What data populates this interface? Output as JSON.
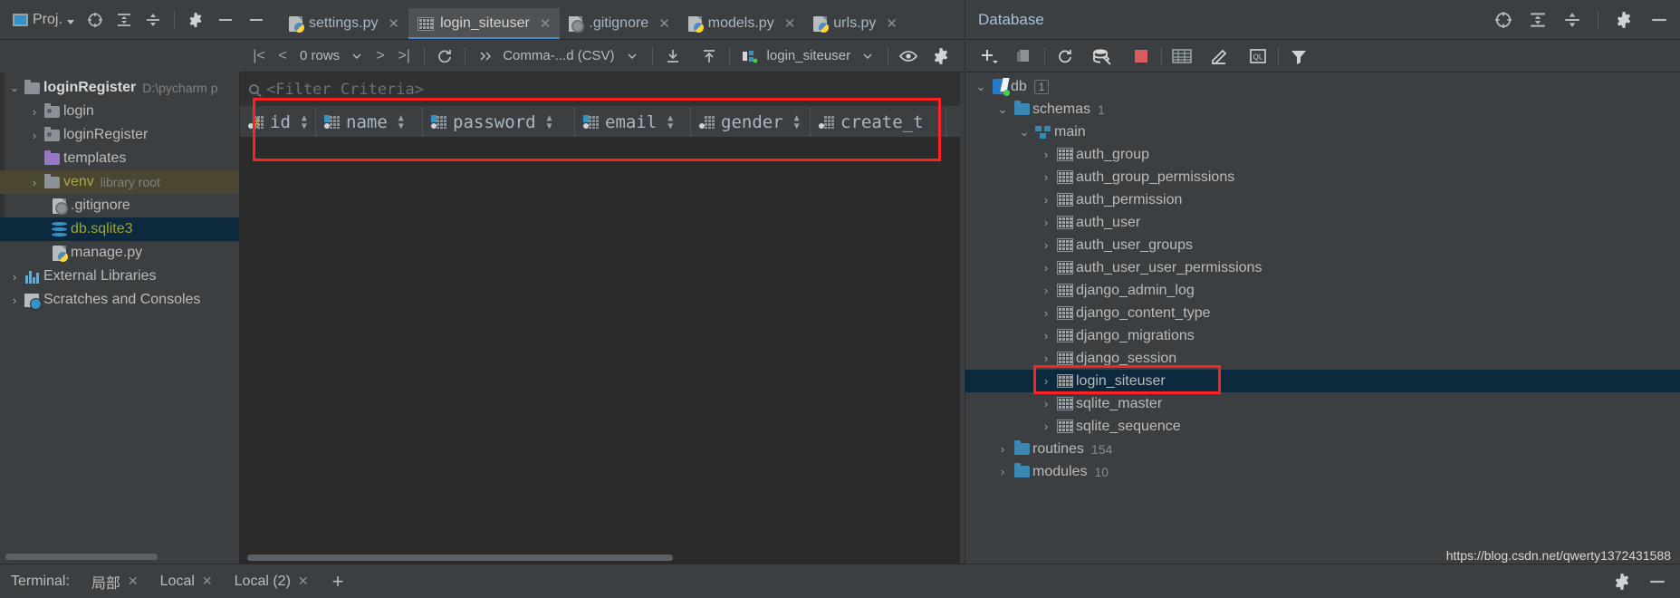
{
  "project_panel": {
    "title": "Proj.",
    "header_icons": [
      "locate-icon",
      "expand-all-icon",
      "collapse-all-icon",
      "settings-gear-icon",
      "minimize-icon"
    ],
    "tree": [
      {
        "name": "loginRegister",
        "sub": "D:\\pycharm p",
        "arrow": "v",
        "icon": "folder-icon",
        "style": "bold",
        "indent": 0
      },
      {
        "name": "login",
        "sub": "",
        "arrow": ">",
        "icon": "module-folder-icon",
        "style": "normal",
        "indent": 1
      },
      {
        "name": "loginRegister",
        "sub": "",
        "arrow": ">",
        "icon": "module-folder-icon",
        "style": "normal",
        "indent": 1
      },
      {
        "name": "templates",
        "sub": "",
        "arrow": "",
        "icon": "folder-purple-icon",
        "style": "normal",
        "indent": 1
      },
      {
        "name": "venv",
        "sub": "library root",
        "arrow": ">",
        "icon": "folder-icon",
        "style": "venv",
        "indent": 1
      },
      {
        "name": ".gitignore",
        "sub": "",
        "arrow": "",
        "icon": "gitignore-file-icon",
        "style": "normal",
        "indent": 2
      },
      {
        "name": "db.sqlite3",
        "sub": "",
        "arrow": "",
        "icon": "database-file-icon",
        "style": "green",
        "indent": 2
      },
      {
        "name": "manage.py",
        "sub": "",
        "arrow": "",
        "icon": "python-file-icon",
        "style": "normal",
        "indent": 2
      },
      {
        "name": "External Libraries",
        "sub": "",
        "arrow": ">",
        "icon": "libraries-icon",
        "style": "normal",
        "indent": 0
      },
      {
        "name": "Scratches and Consoles",
        "sub": "",
        "arrow": ">",
        "icon": "scratches-icon",
        "style": "normal",
        "indent": 0
      }
    ]
  },
  "editor": {
    "tabs": [
      {
        "label": "settings.py",
        "icon": "python-file-icon",
        "active": false
      },
      {
        "label": "login_siteuser",
        "icon": "table-icon",
        "active": true
      },
      {
        "label": ".gitignore",
        "icon": "gitignore-file-icon",
        "active": false
      },
      {
        "label": "models.py",
        "icon": "python-file-icon",
        "active": false
      },
      {
        "label": "urls.py",
        "icon": "python-file-icon",
        "active": false
      }
    ]
  },
  "grid_toolbar": {
    "first_page": "|<",
    "prev_page": "<",
    "rows_label": "0 rows",
    "next_page": ">",
    "last_page": ">|",
    "reload_icon": "refresh-icon",
    "more_icon": "chevron-double-right-icon",
    "format_label": "Comma-...d (CSV)",
    "download_icon": "download-icon",
    "upload_icon": "upload-icon",
    "session_label": "login_siteuser",
    "view_icon": "eye-icon",
    "settings_icon": "gear-icon"
  },
  "grid": {
    "filter_placeholder": "<Filter Criteria>",
    "columns": [
      {
        "name": "id",
        "icon": "primary-key-column-icon"
      },
      {
        "name": "name",
        "icon": "text-column-icon"
      },
      {
        "name": "password",
        "icon": "text-column-icon"
      },
      {
        "name": "email",
        "icon": "text-column-icon"
      },
      {
        "name": "gender",
        "icon": "column-icon"
      },
      {
        "name": "create_t",
        "icon": "column-icon"
      }
    ]
  },
  "database_panel": {
    "title": "Database",
    "header_icons": [
      "locate-icon",
      "expand-all-icon",
      "collapse-all-icon",
      "settings-gear-icon",
      "minimize-icon"
    ],
    "toolbar_icons": [
      "add-icon",
      "duplicate-icon",
      "refresh-icon",
      "datasource-properties-icon",
      "stop-icon",
      "table-editor-icon",
      "modify-icon",
      "query-console-icon",
      "filter-icon"
    ],
    "tree": [
      {
        "name": "db",
        "badge": "1",
        "count": "",
        "arrow": "v",
        "icon": "sqlite-datasource-icon",
        "indent": 0,
        "selected": false
      },
      {
        "name": "schemas",
        "badge": "",
        "count": "1",
        "arrow": "v",
        "icon": "folder-blue-icon",
        "indent": 1,
        "selected": false
      },
      {
        "name": "main",
        "badge": "",
        "count": "",
        "arrow": "v",
        "icon": "schema-icon",
        "indent": 2,
        "selected": false
      },
      {
        "name": "auth_group",
        "badge": "",
        "count": "",
        "arrow": ">",
        "icon": "table-icon",
        "indent": 3,
        "selected": false
      },
      {
        "name": "auth_group_permissions",
        "badge": "",
        "count": "",
        "arrow": ">",
        "icon": "table-icon",
        "indent": 3,
        "selected": false
      },
      {
        "name": "auth_permission",
        "badge": "",
        "count": "",
        "arrow": ">",
        "icon": "table-icon",
        "indent": 3,
        "selected": false
      },
      {
        "name": "auth_user",
        "badge": "",
        "count": "",
        "arrow": ">",
        "icon": "table-icon",
        "indent": 3,
        "selected": false
      },
      {
        "name": "auth_user_groups",
        "badge": "",
        "count": "",
        "arrow": ">",
        "icon": "table-icon",
        "indent": 3,
        "selected": false
      },
      {
        "name": "auth_user_user_permissions",
        "badge": "",
        "count": "",
        "arrow": ">",
        "icon": "table-icon",
        "indent": 3,
        "selected": false
      },
      {
        "name": "django_admin_log",
        "badge": "",
        "count": "",
        "arrow": ">",
        "icon": "table-icon",
        "indent": 3,
        "selected": false
      },
      {
        "name": "django_content_type",
        "badge": "",
        "count": "",
        "arrow": ">",
        "icon": "table-icon",
        "indent": 3,
        "selected": false
      },
      {
        "name": "django_migrations",
        "badge": "",
        "count": "",
        "arrow": ">",
        "icon": "table-icon",
        "indent": 3,
        "selected": false
      },
      {
        "name": "django_session",
        "badge": "",
        "count": "",
        "arrow": ">",
        "icon": "table-icon",
        "indent": 3,
        "selected": false
      },
      {
        "name": "login_siteuser",
        "badge": "",
        "count": "",
        "arrow": ">",
        "icon": "table-icon",
        "indent": 3,
        "selected": true
      },
      {
        "name": "sqlite_master",
        "badge": "",
        "count": "",
        "arrow": ">",
        "icon": "table-icon",
        "indent": 3,
        "selected": false
      },
      {
        "name": "sqlite_sequence",
        "badge": "",
        "count": "",
        "arrow": ">",
        "icon": "table-icon",
        "indent": 3,
        "selected": false
      },
      {
        "name": "routines",
        "badge": "",
        "count": "154",
        "arrow": ">",
        "icon": "folder-blue-icon",
        "indent": 1,
        "selected": false
      },
      {
        "name": "modules",
        "badge": "",
        "count": "10",
        "arrow": ">",
        "icon": "folder-blue-icon",
        "indent": 1,
        "selected": false
      }
    ]
  },
  "bottom_bar": {
    "terminal_label": "Terminal:",
    "tabs": [
      {
        "label": "局部"
      },
      {
        "label": "Local"
      },
      {
        "label": "Local (2)"
      }
    ],
    "add_label": "+"
  },
  "watermark": "https://blog.csdn.net/qwerty1372431588",
  "colors": {
    "accent_blue": "#3592c4",
    "selection": "#0d293e",
    "highlight_red": "#ff2020",
    "tab_underline": "#4a88c7",
    "text": "#bbbbbb"
  }
}
